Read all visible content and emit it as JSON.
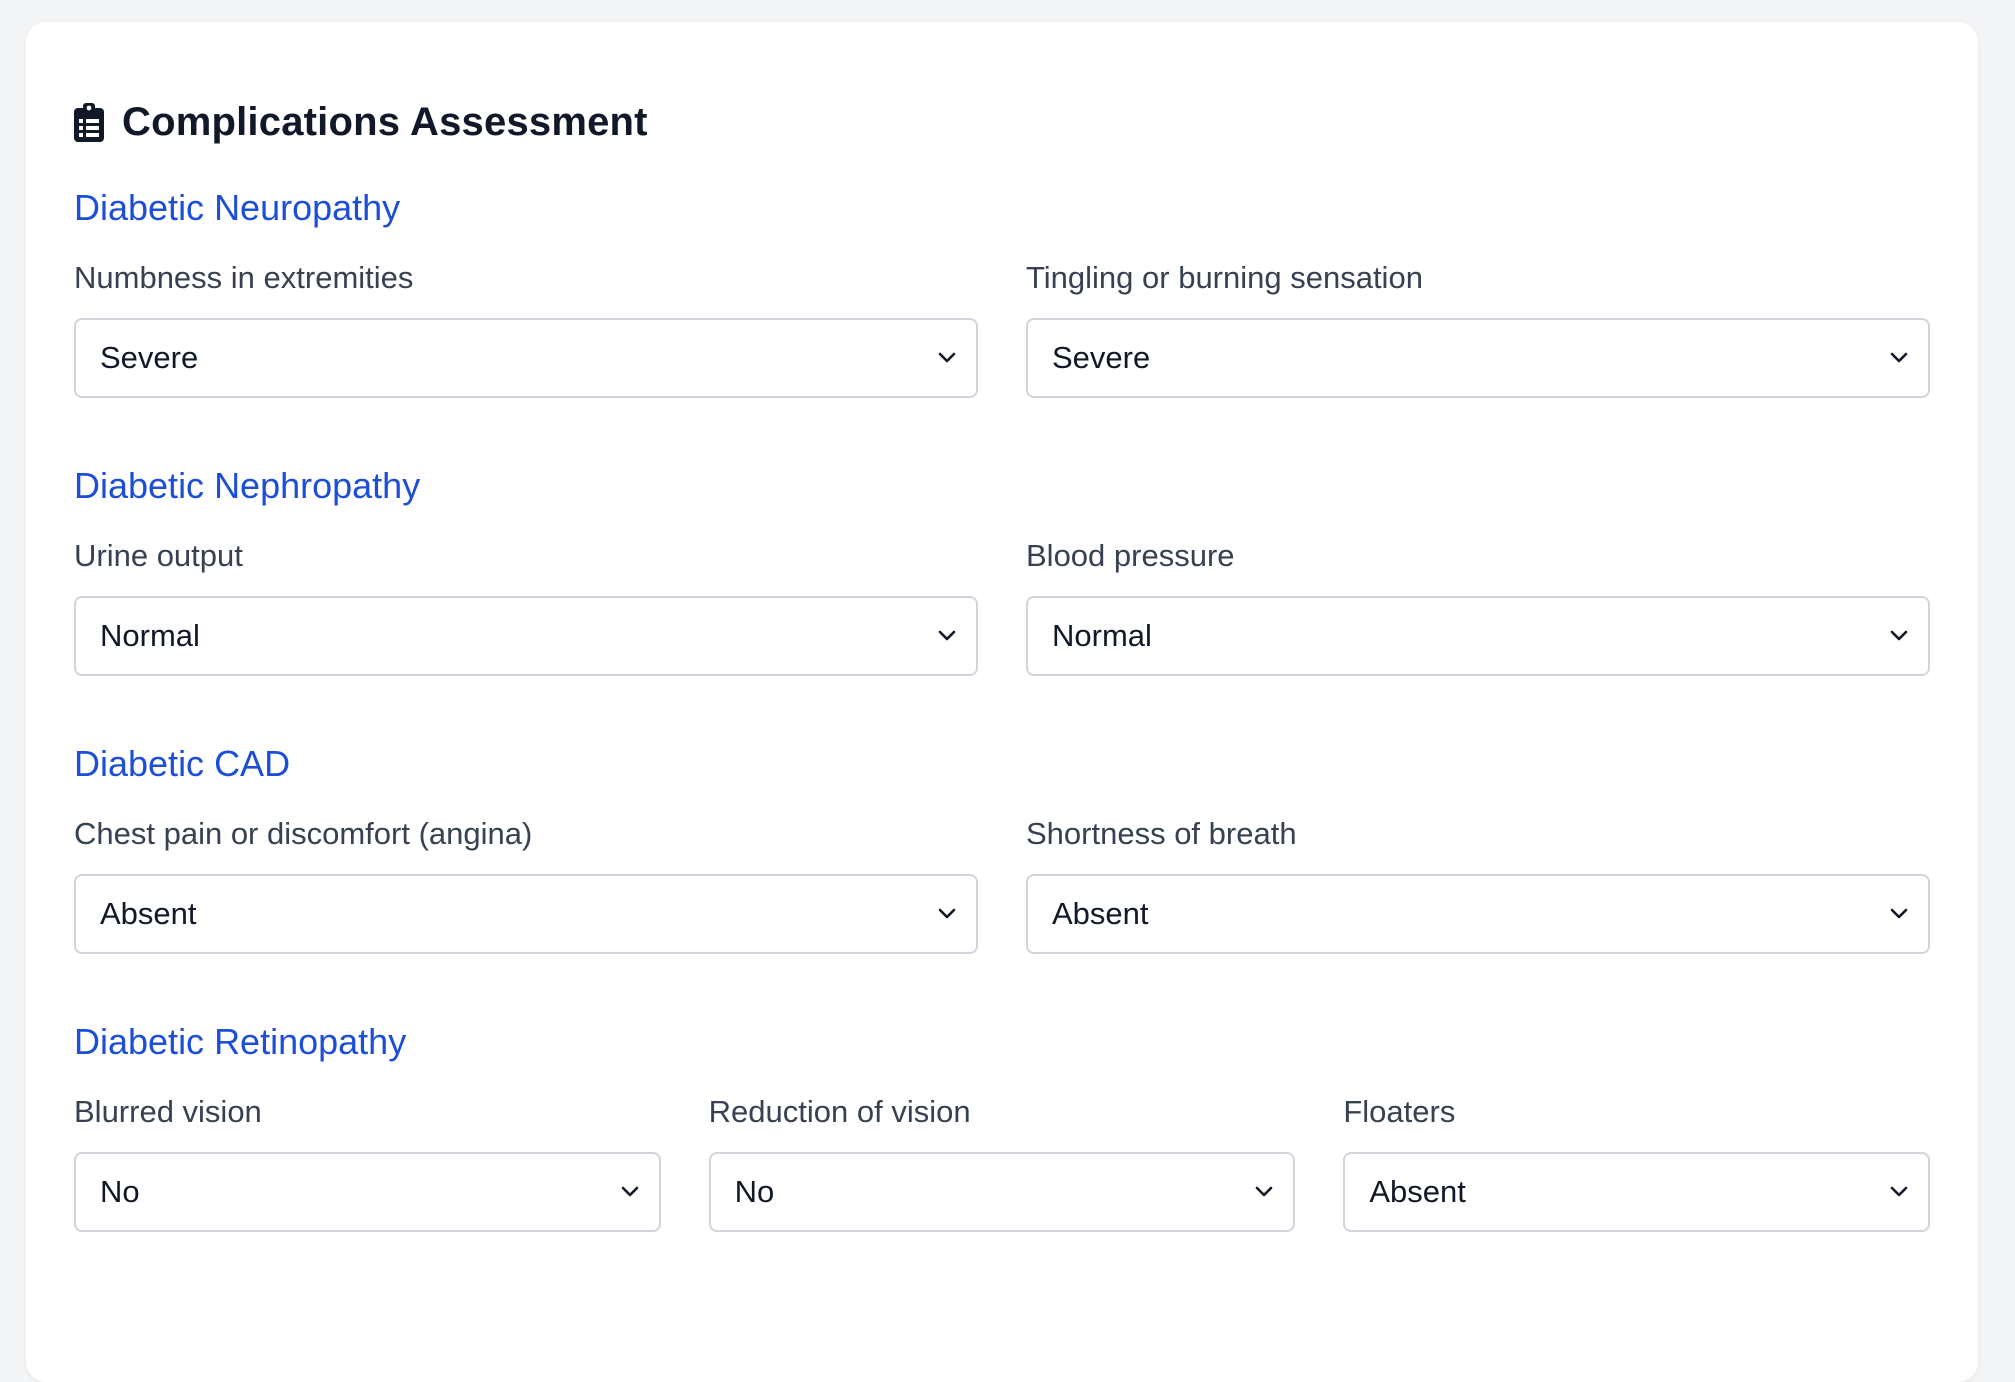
{
  "header": {
    "title": "Complications Assessment",
    "icon": "clipboard-list-icon"
  },
  "colors": {
    "section_title": "#1d4ed8",
    "page_background": "#f3f4f6",
    "card_background": "#ffffff",
    "border": "#d1d5db"
  },
  "sections": [
    {
      "title": "Diabetic Neuropathy",
      "fields": [
        {
          "label": "Numbness in extremities",
          "value": "Severe"
        },
        {
          "label": "Tingling or burning sensation",
          "value": "Severe"
        }
      ]
    },
    {
      "title": "Diabetic Nephropathy",
      "fields": [
        {
          "label": "Urine output",
          "value": "Normal"
        },
        {
          "label": "Blood pressure",
          "value": "Normal"
        }
      ]
    },
    {
      "title": "Diabetic CAD",
      "fields": [
        {
          "label": "Chest pain or discomfort (angina)",
          "value": "Absent"
        },
        {
          "label": "Shortness of breath",
          "value": "Absent"
        }
      ]
    },
    {
      "title": "Diabetic Retinopathy",
      "fields": [
        {
          "label": "Blurred vision",
          "value": "No"
        },
        {
          "label": "Reduction of vision",
          "value": "No"
        },
        {
          "label": "Floaters",
          "value": "Absent"
        }
      ]
    }
  ]
}
